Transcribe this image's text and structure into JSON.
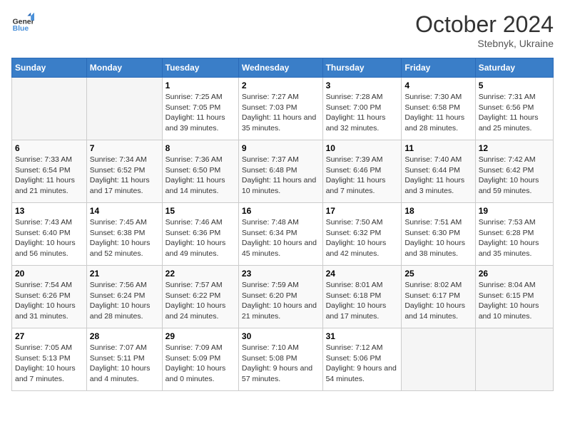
{
  "header": {
    "logo_line1": "General",
    "logo_line2": "Blue",
    "month": "October 2024",
    "location": "Stebnyk, Ukraine"
  },
  "weekdays": [
    "Sunday",
    "Monday",
    "Tuesday",
    "Wednesday",
    "Thursday",
    "Friday",
    "Saturday"
  ],
  "weeks": [
    [
      {
        "day": "",
        "info": ""
      },
      {
        "day": "",
        "info": ""
      },
      {
        "day": "1",
        "info": "Sunrise: 7:25 AM\nSunset: 7:05 PM\nDaylight: 11 hours and 39 minutes."
      },
      {
        "day": "2",
        "info": "Sunrise: 7:27 AM\nSunset: 7:03 PM\nDaylight: 11 hours and 35 minutes."
      },
      {
        "day": "3",
        "info": "Sunrise: 7:28 AM\nSunset: 7:00 PM\nDaylight: 11 hours and 32 minutes."
      },
      {
        "day": "4",
        "info": "Sunrise: 7:30 AM\nSunset: 6:58 PM\nDaylight: 11 hours and 28 minutes."
      },
      {
        "day": "5",
        "info": "Sunrise: 7:31 AM\nSunset: 6:56 PM\nDaylight: 11 hours and 25 minutes."
      }
    ],
    [
      {
        "day": "6",
        "info": "Sunrise: 7:33 AM\nSunset: 6:54 PM\nDaylight: 11 hours and 21 minutes."
      },
      {
        "day": "7",
        "info": "Sunrise: 7:34 AM\nSunset: 6:52 PM\nDaylight: 11 hours and 17 minutes."
      },
      {
        "day": "8",
        "info": "Sunrise: 7:36 AM\nSunset: 6:50 PM\nDaylight: 11 hours and 14 minutes."
      },
      {
        "day": "9",
        "info": "Sunrise: 7:37 AM\nSunset: 6:48 PM\nDaylight: 11 hours and 10 minutes."
      },
      {
        "day": "10",
        "info": "Sunrise: 7:39 AM\nSunset: 6:46 PM\nDaylight: 11 hours and 7 minutes."
      },
      {
        "day": "11",
        "info": "Sunrise: 7:40 AM\nSunset: 6:44 PM\nDaylight: 11 hours and 3 minutes."
      },
      {
        "day": "12",
        "info": "Sunrise: 7:42 AM\nSunset: 6:42 PM\nDaylight: 10 hours and 59 minutes."
      }
    ],
    [
      {
        "day": "13",
        "info": "Sunrise: 7:43 AM\nSunset: 6:40 PM\nDaylight: 10 hours and 56 minutes."
      },
      {
        "day": "14",
        "info": "Sunrise: 7:45 AM\nSunset: 6:38 PM\nDaylight: 10 hours and 52 minutes."
      },
      {
        "day": "15",
        "info": "Sunrise: 7:46 AM\nSunset: 6:36 PM\nDaylight: 10 hours and 49 minutes."
      },
      {
        "day": "16",
        "info": "Sunrise: 7:48 AM\nSunset: 6:34 PM\nDaylight: 10 hours and 45 minutes."
      },
      {
        "day": "17",
        "info": "Sunrise: 7:50 AM\nSunset: 6:32 PM\nDaylight: 10 hours and 42 minutes."
      },
      {
        "day": "18",
        "info": "Sunrise: 7:51 AM\nSunset: 6:30 PM\nDaylight: 10 hours and 38 minutes."
      },
      {
        "day": "19",
        "info": "Sunrise: 7:53 AM\nSunset: 6:28 PM\nDaylight: 10 hours and 35 minutes."
      }
    ],
    [
      {
        "day": "20",
        "info": "Sunrise: 7:54 AM\nSunset: 6:26 PM\nDaylight: 10 hours and 31 minutes."
      },
      {
        "day": "21",
        "info": "Sunrise: 7:56 AM\nSunset: 6:24 PM\nDaylight: 10 hours and 28 minutes."
      },
      {
        "day": "22",
        "info": "Sunrise: 7:57 AM\nSunset: 6:22 PM\nDaylight: 10 hours and 24 minutes."
      },
      {
        "day": "23",
        "info": "Sunrise: 7:59 AM\nSunset: 6:20 PM\nDaylight: 10 hours and 21 minutes."
      },
      {
        "day": "24",
        "info": "Sunrise: 8:01 AM\nSunset: 6:18 PM\nDaylight: 10 hours and 17 minutes."
      },
      {
        "day": "25",
        "info": "Sunrise: 8:02 AM\nSunset: 6:17 PM\nDaylight: 10 hours and 14 minutes."
      },
      {
        "day": "26",
        "info": "Sunrise: 8:04 AM\nSunset: 6:15 PM\nDaylight: 10 hours and 10 minutes."
      }
    ],
    [
      {
        "day": "27",
        "info": "Sunrise: 7:05 AM\nSunset: 5:13 PM\nDaylight: 10 hours and 7 minutes."
      },
      {
        "day": "28",
        "info": "Sunrise: 7:07 AM\nSunset: 5:11 PM\nDaylight: 10 hours and 4 minutes."
      },
      {
        "day": "29",
        "info": "Sunrise: 7:09 AM\nSunset: 5:09 PM\nDaylight: 10 hours and 0 minutes."
      },
      {
        "day": "30",
        "info": "Sunrise: 7:10 AM\nSunset: 5:08 PM\nDaylight: 9 hours and 57 minutes."
      },
      {
        "day": "31",
        "info": "Sunrise: 7:12 AM\nSunset: 5:06 PM\nDaylight: 9 hours and 54 minutes."
      },
      {
        "day": "",
        "info": ""
      },
      {
        "day": "",
        "info": ""
      }
    ]
  ]
}
